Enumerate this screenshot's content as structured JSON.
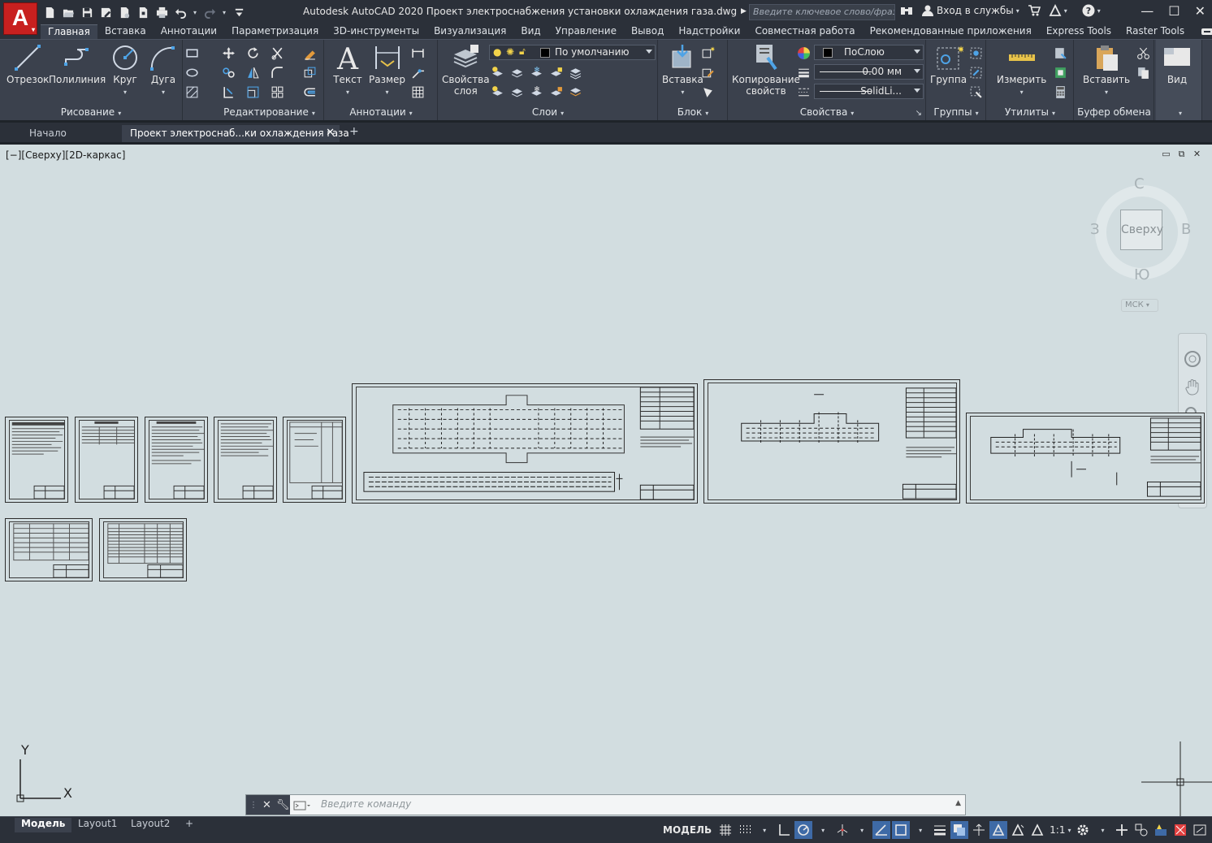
{
  "app": {
    "title": "Autodesk AutoCAD 2020   Проект электроснабжения установки охлаждения газа.dwg",
    "logo_letter": "A",
    "search_placeholder": "Введите ключевое слово/фразу",
    "signin_label": "Вход в службы",
    "colors": {
      "accent_red": "#c8201f",
      "ribbon_bg": "#3b414d",
      "canvas_bg": "#d2dde0",
      "toggle_on": "#3e6aa6"
    }
  },
  "quick_access": [
    "new-icon",
    "open-icon",
    "save-icon",
    "save-as-icon",
    "open-web-icon",
    "save-web-icon",
    "plot-icon",
    "undo-icon",
    "redo-icon",
    "customize-icon"
  ],
  "ribbon_tabs": [
    "Главная",
    "Вставка",
    "Аннотации",
    "Параметризация",
    "3D-инструменты",
    "Визуализация",
    "Вид",
    "Управление",
    "Вывод",
    "Надстройки",
    "Совместная работа",
    "Рекомендованные приложения",
    "Express Tools",
    "Raster Tools"
  ],
  "ribbon": {
    "draw": {
      "title": "Рисование",
      "line": "Отрезок",
      "polyline": "Полилиния",
      "circle": "Круг",
      "arc": "Дуга"
    },
    "modify": {
      "title": "Редактирование"
    },
    "annotation": {
      "title": "Аннотации",
      "text": "Текст",
      "dimension": "Размер"
    },
    "layers": {
      "title": "Слои",
      "properties_1": "Свойства",
      "properties_2": "слоя",
      "current_layer": "По умолчанию"
    },
    "block": {
      "title": "Блок",
      "insert": "Вставка"
    },
    "properties": {
      "title": "Свойства",
      "match_1": "Копирование",
      "match_2": "свойств",
      "color": "ПоСлою",
      "lineweight": "0.00 мм",
      "linetype": "SolidLi..."
    },
    "groups": {
      "title": "Группы",
      "group": "Группа"
    },
    "utilities": {
      "title": "Утилиты",
      "measure": "Измерить"
    },
    "clipboard": {
      "title": "Буфер обмена",
      "paste": "Вставить"
    },
    "view": {
      "title": "Вид"
    }
  },
  "file_tabs": {
    "start": "Начало",
    "active": "Проект электроснаб...ки охлаждения газа"
  },
  "viewport": {
    "label": "[−][Сверху][2D-каркас]",
    "viewcube": {
      "face": "Сверху",
      "north": "С",
      "south": "Ю",
      "west": "З",
      "east": "В",
      "wcs": "МСК"
    },
    "ucs": {
      "x": "X",
      "y": "Y"
    }
  },
  "command_line": {
    "placeholder": "Введите команду"
  },
  "layout_tabs": [
    "Модель",
    "Layout1",
    "Layout2"
  ],
  "status": {
    "model": "МОДЕЛЬ",
    "scale": "1:1"
  }
}
